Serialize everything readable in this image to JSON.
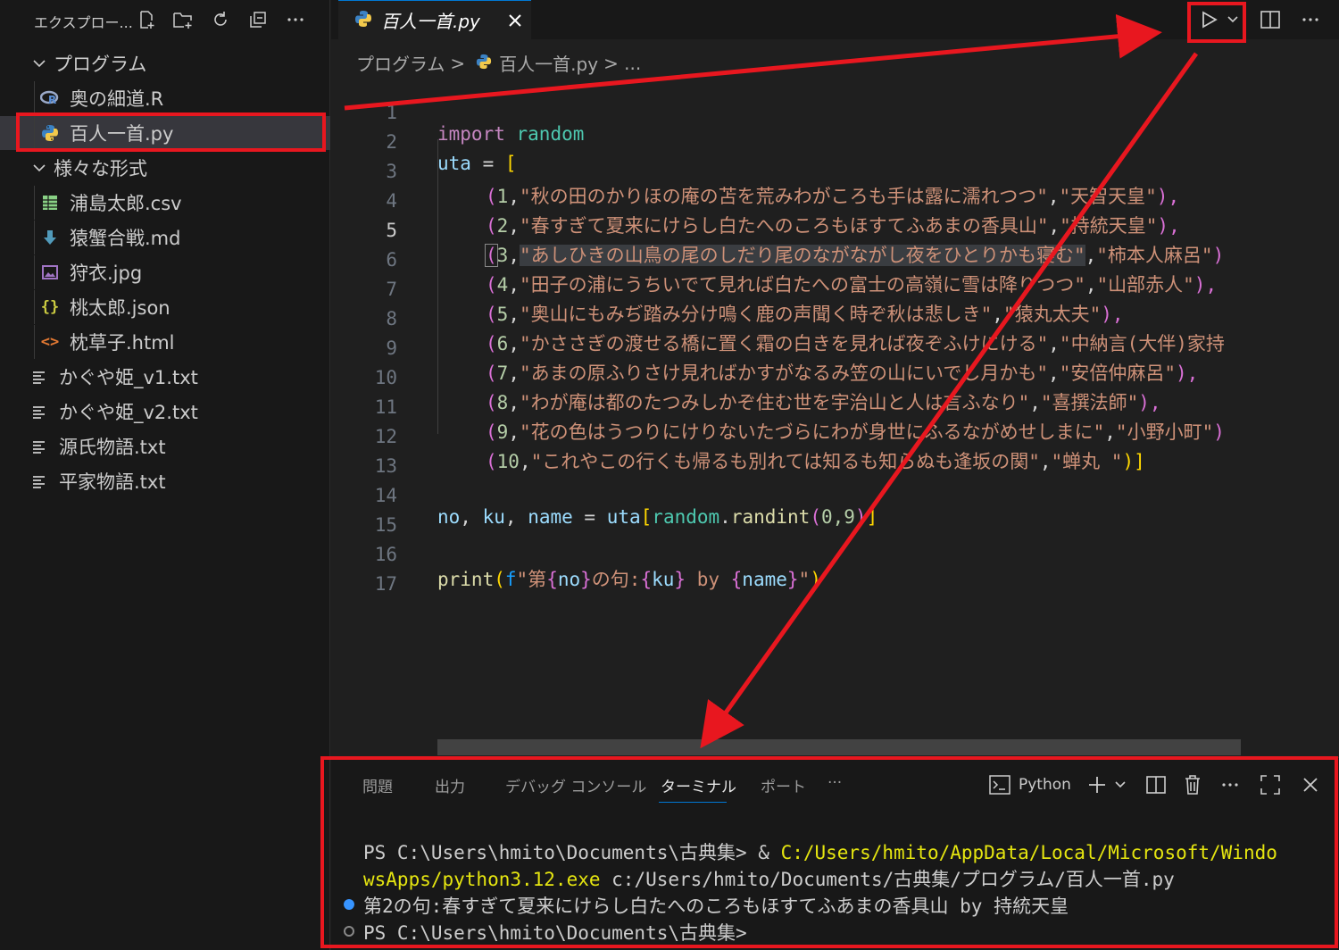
{
  "sidebar": {
    "title": "エクスプロー...",
    "folders": [
      {
        "label": "プログラム"
      },
      {
        "label": "様々な形式"
      }
    ],
    "items": [
      {
        "label": "奥の細道.R",
        "icon": "r-file-icon"
      },
      {
        "label": "百人一首.py",
        "icon": "python-file-icon"
      },
      {
        "label": "浦島太郎.csv",
        "icon": "csv-file-icon"
      },
      {
        "label": "猿蟹合戦.md",
        "icon": "markdown-file-icon"
      },
      {
        "label": "狩衣.jpg",
        "icon": "image-file-icon"
      },
      {
        "label": "桃太郎.json",
        "icon": "json-file-icon"
      },
      {
        "label": "枕草子.html",
        "icon": "html-file-icon"
      },
      {
        "label": "かぐや姫_v1.txt",
        "icon": "text-file-icon"
      },
      {
        "label": "かぐや姫_v2.txt",
        "icon": "text-file-icon"
      },
      {
        "label": "源氏物語.txt",
        "icon": "text-file-icon"
      },
      {
        "label": "平家物語.txt",
        "icon": "text-file-icon"
      }
    ]
  },
  "editor": {
    "tab_label": "百人一首.py",
    "breadcrumb": {
      "folder": "プログラム",
      "sep": ">",
      "file": "百人一首.py",
      "more": "> ..."
    },
    "line_numbers": [
      "1",
      "2",
      "3",
      "4",
      "5",
      "6",
      "7",
      "8",
      "9",
      "10",
      "11",
      "12",
      "13",
      "14",
      "15",
      "16",
      "17"
    ],
    "current_line": "5",
    "code": {
      "l1_kw": "import",
      "l1_mod": "random",
      "l2_var": "uta",
      "l2_op": " = ",
      "l2_br": "[",
      "rows": [
        {
          "n": "1",
          "ku": "\"秋の田のかりほの庵の苫を荒みわがころも手は露に濡れつつ\"",
          "name": "\"天智天皇\"",
          "tail": "),"
        },
        {
          "n": "2",
          "ku": "\"春すぎて夏来にけらし白たへのころもほすてふあまの香具山\"",
          "name": "\"持統天皇\"",
          "tail": "),"
        },
        {
          "n": "3",
          "ku": "\"あしひきの山鳥の尾のしだり尾のながながし夜をひとりかも寝む\"",
          "name": "\"柿本人麻呂\"",
          "tail": ")"
        },
        {
          "n": "4",
          "ku": "\"田子の浦にうちいでて見れば白たへの富士の高嶺に雪は降りつつ\"",
          "name": "\"山部赤人\"",
          "tail": "),"
        },
        {
          "n": "5",
          "ku": "\"奥山にもみぢ踏み分け鳴く鹿の声聞く時ぞ秋は悲しき\"",
          "name": "\"猿丸太夫\"",
          "tail": "),"
        },
        {
          "n": "6",
          "ku": "\"かささぎの渡せる橋に置く霜の白きを見れば夜ぞふけにける\"",
          "name": "\"中納言(大伴)家持",
          "tail": ""
        },
        {
          "n": "7",
          "ku": "\"あまの原ふりさけ見ればかすがなるみ笠の山にいでし月かも\"",
          "name": "\"安倍仲麻呂\"",
          "tail": "),"
        },
        {
          "n": "8",
          "ku": "\"わが庵は都のたつみしかぞ住む世を宇治山と人は言ふなり\"",
          "name": "\"喜撰法師\"",
          "tail": "),"
        },
        {
          "n": "9",
          "ku": "\"花の色はうつりにけりないたづらにわが身世にふるながめせしまに\"",
          "name": "\"小野小町\"",
          "tail": ")"
        },
        {
          "n": "10",
          "ku": "\"これやこの行くも帰るも別れては知るも知らぬも逢坂の関\"",
          "name": "\"蝉丸 \"",
          "tail": ")]"
        }
      ],
      "l14": {
        "a": "no",
        "b": "ku",
        "c": "name",
        "eq": " = ",
        "uta": "uta",
        "mod": "random",
        "fn": "randint",
        "args": "0,9"
      },
      "l16": {
        "fn": "print",
        "f": "f",
        "q1": "\"第",
        "no": "no",
        "mid": "の句:",
        "ku": "ku",
        "by": " by ",
        "name": "name",
        "q2": "\""
      }
    }
  },
  "panel": {
    "tabs": [
      "問題",
      "出力",
      "デバッグ コンソール",
      "ターミナル",
      "ポート",
      "···"
    ],
    "active_tab": "ターミナル",
    "terminal_label": "Python",
    "terminal": {
      "line1_prompt": "PS C:\\Users\\hmito\\Documents\\古典集> & ",
      "line1_path": "C:/Users/hmito/AppData/Local/Microsoft/Windo",
      "line2_path": "wsApps/python3.12.exe",
      "line2_arg": " c:/Users/hmito/Documents/古典集/プログラム/百人一首.py",
      "line3": "第2の句:春すぎて夏来にけらし白たへのころもほすてふあまの香具山 by 持統天皇",
      "line4": "PS C:\\Users\\hmito\\Documents\\古典集>"
    }
  },
  "colors": {
    "accent": "#0078d4",
    "annotation": "#e8171f",
    "terminal_path": "#e5e510"
  }
}
